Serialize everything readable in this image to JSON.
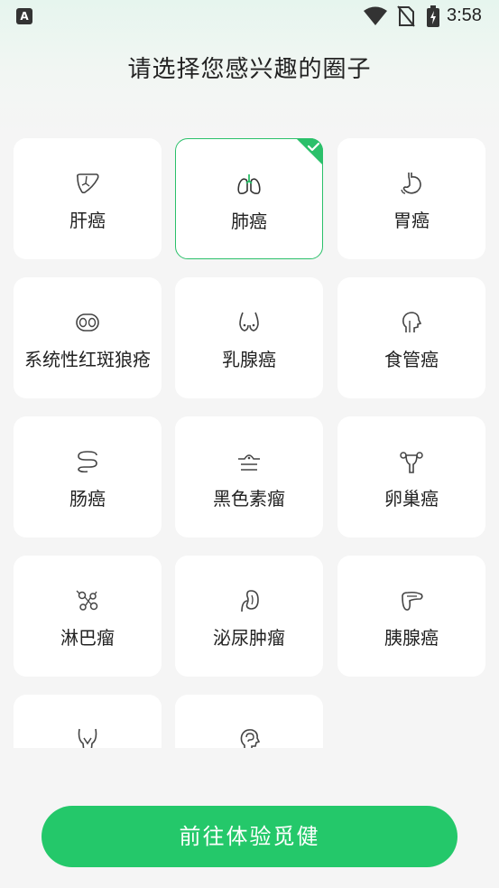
{
  "status_bar": {
    "notif_icon_letter": "A",
    "time": "3:58"
  },
  "title": "请选择您感兴趣的圈子",
  "circles": [
    {
      "label": "肝癌",
      "icon": "liver-icon",
      "selected": false
    },
    {
      "label": "肺癌",
      "icon": "lungs-icon",
      "selected": true
    },
    {
      "label": "胃癌",
      "icon": "stomach-icon",
      "selected": false
    },
    {
      "label": "系统性红斑狼疮",
      "icon": "kidneys-icon",
      "selected": false
    },
    {
      "label": "乳腺癌",
      "icon": "breast-icon",
      "selected": false
    },
    {
      "label": "食管癌",
      "icon": "head-profile-icon",
      "selected": false
    },
    {
      "label": "肠癌",
      "icon": "intestine-icon",
      "selected": false
    },
    {
      "label": "黑色素瘤",
      "icon": "skin-layer-icon",
      "selected": false
    },
    {
      "label": "卵巢癌",
      "icon": "uterus-icon",
      "selected": false
    },
    {
      "label": "淋巴瘤",
      "icon": "lymph-nodes-icon",
      "selected": false
    },
    {
      "label": "泌尿肿瘤",
      "icon": "kidney-icon",
      "selected": false
    },
    {
      "label": "胰腺癌",
      "icon": "pancreas-icon",
      "selected": false
    },
    {
      "label": "",
      "icon": "pelvis-icon",
      "selected": false
    },
    {
      "label": "",
      "icon": "brain-head-icon",
      "selected": false
    }
  ],
  "cta_label": "前往体验觅健",
  "colors": {
    "accent": "#24c86a",
    "selected_border": "#2bc06a",
    "background": "#f5f5f5"
  }
}
